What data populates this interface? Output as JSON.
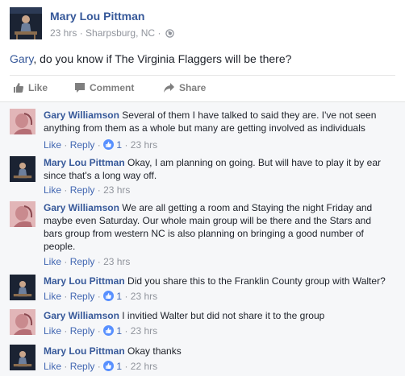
{
  "post": {
    "author": "Mary Lou Pittman",
    "time": "23 hrs",
    "location": "Sharpsburg, NC",
    "separator": "·",
    "mention": "Gary",
    "text": ", do you know if The Virginia Flaggers will be there?",
    "privacy_icon": "globe-icon"
  },
  "actions": [
    {
      "label": "Like",
      "icon": "thumbs-up-icon"
    },
    {
      "label": "Comment",
      "icon": "speech-bubble-icon"
    },
    {
      "label": "Share",
      "icon": "share-arrow-icon"
    }
  ],
  "comment_links": {
    "like": "Like",
    "reply": "Reply",
    "dot": "·"
  },
  "comments": [
    {
      "author": "Gary Williamson",
      "text": "Several of them I have talked to said they are. I've not seen anything from them as a whole but many are getting involved as individuals",
      "likes": "1",
      "time": "23 hrs"
    },
    {
      "author": "Mary Lou Pittman",
      "text": "Okay, I am planning on going. But will have to play it by ear since that's a long way off.",
      "likes": "",
      "time": "23 hrs"
    },
    {
      "author": "Gary Williamson",
      "text": "We are all getting a room and Staying the night Friday and maybe even Saturday. Our whole main group will be there and the Stars and bars group from western NC is also planning on bringing a good number of people.",
      "likes": "",
      "time": "23 hrs"
    },
    {
      "author": "Mary Lou Pittman",
      "text": "Did you share this to the Franklin County group with Walter?",
      "likes": "1",
      "time": "23 hrs"
    },
    {
      "author": "Gary Williamson",
      "text": "I invitied Walter but did not share it to the group",
      "likes": "1",
      "time": "23 hrs"
    },
    {
      "author": "Mary Lou Pittman",
      "text": "Okay thanks",
      "likes": "1",
      "time": "22 hrs"
    }
  ],
  "colors": {
    "link": "#365899",
    "meta": "#90949c",
    "like_badge": "#5890ff",
    "comments_bg": "#f6f7f9"
  }
}
